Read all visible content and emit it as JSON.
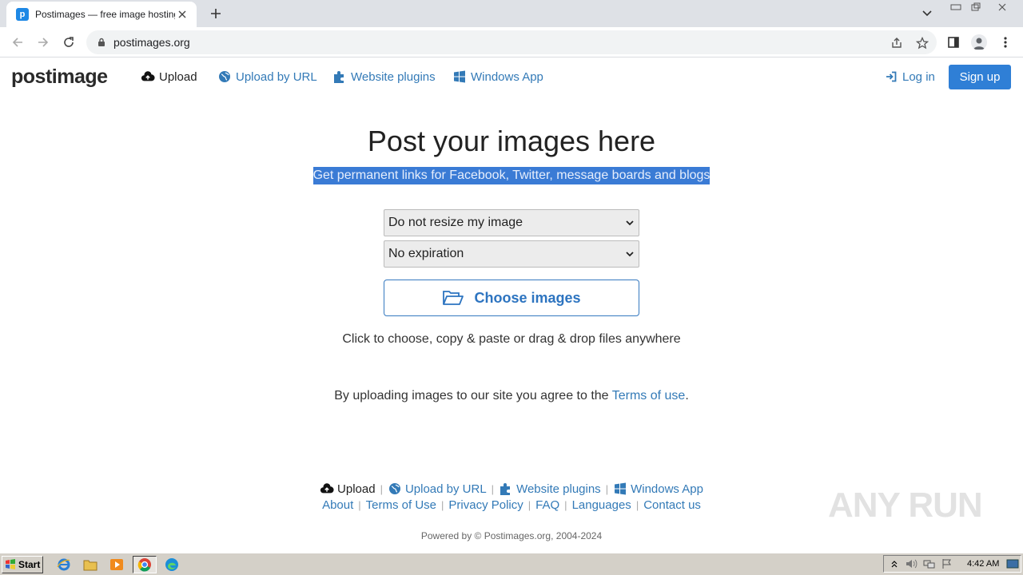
{
  "browser": {
    "tab_title": "Postimages — free image hosting / image upload",
    "tab_favicon_letter": "p",
    "url": "postimages.org"
  },
  "header": {
    "logo": "postimage",
    "nav": [
      {
        "label": "Upload",
        "icon": "cloud-upload-icon"
      },
      {
        "label": "Upload by URL",
        "icon": "globe-icon"
      },
      {
        "label": "Website plugins",
        "icon": "puzzle-icon"
      },
      {
        "label": "Windows App",
        "icon": "windows-icon"
      }
    ],
    "login_label": "Log in",
    "signup_label": "Sign up"
  },
  "main": {
    "headline": "Post your images here",
    "subline": "Get permanent links for Facebook, Twitter, message boards and blogs",
    "resize_select": "Do not resize my image",
    "expiration_select": "No expiration",
    "choose_label": "Choose images",
    "hint": "Click to choose, copy & paste or drag & drop files anywhere",
    "agree_prefix": "By uploading images to our site you agree to the ",
    "agree_link": "Terms of use",
    "agree_suffix": "."
  },
  "footer": {
    "row1": [
      {
        "label": "Upload",
        "icon": "cloud-upload-icon"
      },
      {
        "label": "Upload by URL",
        "icon": "globe-icon"
      },
      {
        "label": "Website plugins",
        "icon": "puzzle-icon"
      },
      {
        "label": "Windows App",
        "icon": "windows-icon"
      }
    ],
    "row2": [
      "About",
      "Terms of Use",
      "Privacy Policy",
      "FAQ",
      "Languages",
      "Contact us"
    ],
    "powered": "Powered by © Postimages.org, 2004-2024"
  },
  "watermark": "ANY RUN",
  "taskbar": {
    "start_label": "Start",
    "clock": "4:42 AM"
  },
  "colors": {
    "link": "#337ab7",
    "signup_bg": "#2f7fd6",
    "highlight": "#3a7bd5"
  }
}
